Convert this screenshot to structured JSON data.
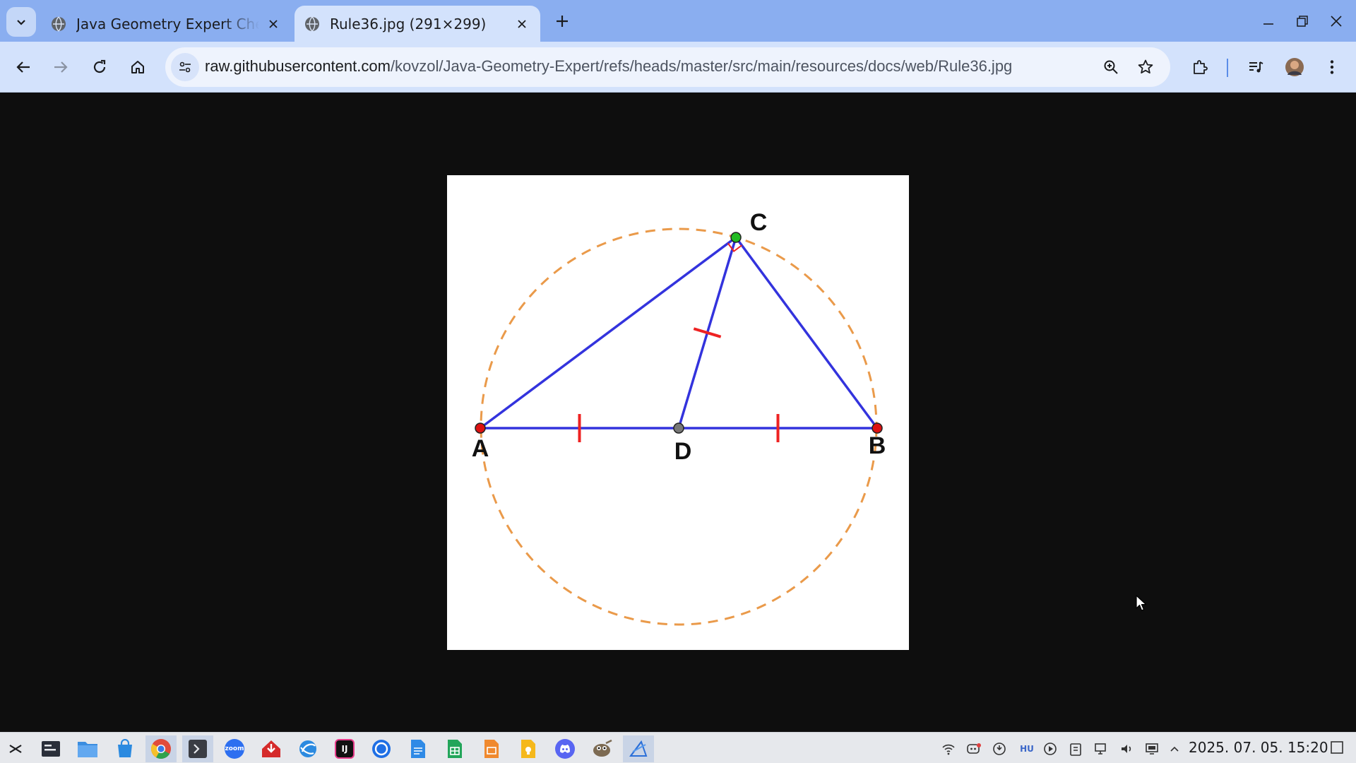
{
  "browser": {
    "tabs": [
      {
        "title": "Java Geometry Expert Chee",
        "active": false,
        "favicon": "globe-icon"
      },
      {
        "title": "Rule36.jpg (291×299)",
        "active": true,
        "favicon": "globe-icon"
      }
    ],
    "window_controls": [
      "minimize-icon",
      "restore-icon",
      "close-icon"
    ],
    "url_host": "raw.githubusercontent.com",
    "url_path": "/kovzol/Java-Geometry-Expert/refs/heads/master/src/main/resources/docs/web/Rule36.jpg",
    "omnibox_icons": [
      "zoom-icon",
      "bookmark-star-icon"
    ],
    "toolbar_icons": [
      "back-icon",
      "forward-icon",
      "reload-icon",
      "home-icon",
      "extensions-icon",
      "media-control-icon",
      "profile-avatar",
      "menu-icon"
    ]
  },
  "figure": {
    "points": [
      {
        "label": "A",
        "role": "triangle vertex",
        "color": "#dd1111"
      },
      {
        "label": "B",
        "role": "triangle vertex",
        "color": "#dd1111"
      },
      {
        "label": "C",
        "role": "triangle vertex on circle",
        "color": "#22bb22"
      },
      {
        "label": "D",
        "role": "midpoint of AB",
        "color": "#777777"
      }
    ],
    "segments": [
      "AC",
      "CB",
      "AB",
      "CD"
    ],
    "equal_marks": [
      "AD",
      "DB",
      "CD"
    ],
    "right_angle_at": "C",
    "circle": {
      "diameter": "AB",
      "style": "dashed",
      "color": "#ea9a4a"
    },
    "line_color": "#3333dd",
    "mark_color": "#ee2222"
  },
  "taskbar": {
    "apps": [
      "launcher-icon",
      "terminal-panel-icon",
      "file-manager-icon",
      "store-icon",
      "chrome-icon",
      "terminal-icon",
      "zoom-icon",
      "pdf-reader-icon",
      "browser-icon",
      "intellij-icon",
      "messenger-icon",
      "docs-icon",
      "sheets-icon",
      "slides-icon",
      "keep-icon",
      "discord-icon",
      "gimp-icon",
      "geometry-app-icon"
    ],
    "zoom_label": "zoom",
    "ij_label": "IJ",
    "keyboard_layout": "HU",
    "clock": "2025. 07. 05.  15:20",
    "tray_icons": [
      "network-icon",
      "discord-tray-icon",
      "updates-icon",
      "keyboard-layout-icon",
      "media-icon",
      "clipboard-icon",
      "display-icon",
      "volume-icon",
      "screen-icon",
      "tray-expand-icon"
    ]
  }
}
